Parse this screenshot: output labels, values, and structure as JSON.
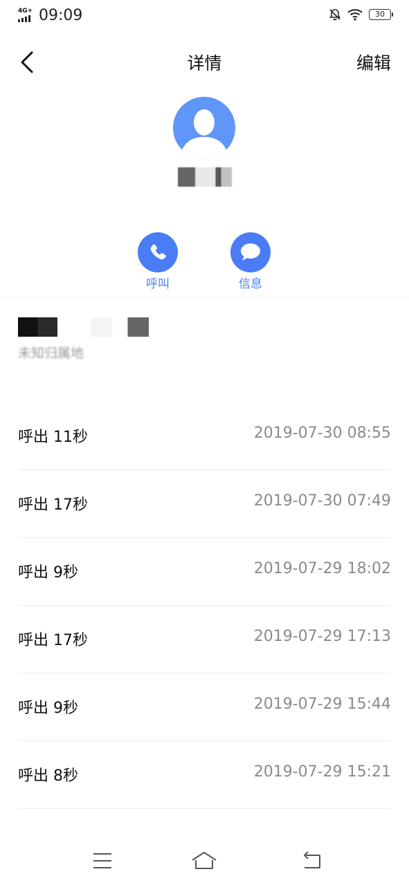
{
  "status_bar": {
    "network": "4G+",
    "time": "09:09",
    "battery": "30"
  },
  "header": {
    "title": "详情",
    "edit_label": "编辑"
  },
  "contact": {
    "name": "",
    "number": "",
    "location": "未知归属地"
  },
  "actions": {
    "call_label": "呼叫",
    "message_label": "信息"
  },
  "call_log": [
    {
      "type": "呼出 11秒",
      "time": "2019-07-30 08:55"
    },
    {
      "type": "呼出 17秒",
      "time": "2019-07-30 07:49"
    },
    {
      "type": "呼出 9秒",
      "time": "2019-07-29 18:02"
    },
    {
      "type": "呼出 17秒",
      "time": "2019-07-29 17:13"
    },
    {
      "type": "呼出 9秒",
      "time": "2019-07-29 15:44"
    },
    {
      "type": "呼出 8秒",
      "time": "2019-07-29 15:21"
    }
  ],
  "colors": {
    "accent": "#4a7cf6",
    "avatar": "#5f96f7",
    "secondary_text": "#8a8a8a"
  }
}
